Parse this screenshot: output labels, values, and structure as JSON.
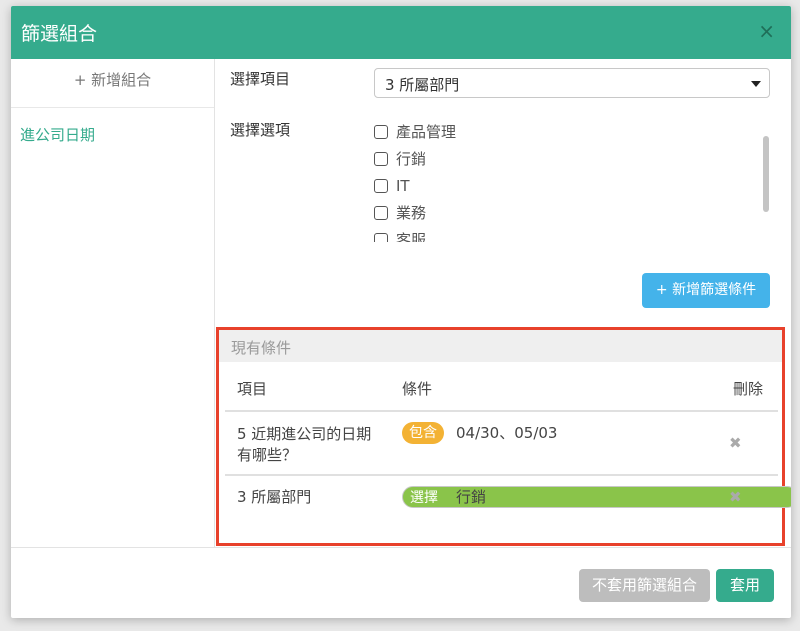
{
  "dialog": {
    "title": "篩選組合",
    "close": "×"
  },
  "sidebar": {
    "add_label": "+ 新增組合",
    "items": [
      "進公司日期"
    ]
  },
  "form": {
    "item_label": "選擇項目",
    "item_value": "3 所屬部門",
    "option_label": "選擇選項",
    "options": [
      "產品管理",
      "行銷",
      "IT",
      "業務",
      "客服"
    ],
    "add_condition_label": "+ 新增篩選條件"
  },
  "conditions": {
    "title": "現有條件",
    "headers": {
      "item": "項目",
      "condition": "條件",
      "delete": "刪除"
    },
    "rows": [
      {
        "item_line1": "5 近期進公司的日期",
        "item_line2": "有哪些？",
        "badge": "包含",
        "value": "04/30、05/03",
        "delete": "✖"
      },
      {
        "item_line1": "3 所屬部門",
        "item_line2": "",
        "badge": "選擇",
        "value": "行銷",
        "delete": "✖"
      }
    ]
  },
  "footer": {
    "cancel_label": "不套用篩選組合",
    "apply_label": "套用"
  },
  "colors": {
    "header": "#35ab8d",
    "highlight_border": "#e8412b",
    "add_button": "#44b3ea",
    "badge_include": "#f3b234",
    "badge_select": "#8ac44a"
  }
}
